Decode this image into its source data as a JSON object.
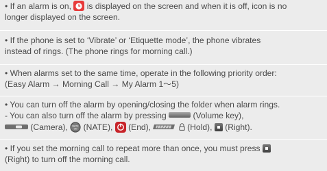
{
  "items": [
    {
      "lines": [
        {
          "pre": "• If an alarm is on,",
          "post": "is displayed on the screen and when it is off, icon is no"
        },
        {
          "text": "longer displayed on the screen."
        }
      ]
    },
    {
      "lines": [
        {
          "text": "• If the phone is set to ‘Vibrate’ or ‘Etiquette mode’, the phone vibrates"
        },
        {
          "text": "instead of rings. (The phone rings for morning call.)"
        }
      ]
    },
    {
      "lines": [
        {
          "text": "• When alarms set to the same time, operate in the following priority order:"
        },
        {
          "text": "(Easy Alarm → Morning Call → My Alarm 1～5)"
        }
      ]
    },
    {
      "lines": [
        {
          "text": "• You can turn off the alarm by opening/closing the folder when alarm rings."
        },
        {
          "pre": "- You can also turn off the alarm by pressing",
          "post": "(Volume key),"
        },
        {
          "t1": "(Camera),",
          "t2": "(NATE),",
          "t3": "(End),",
          "t4": "(Hold),",
          "t5": "(Right)."
        }
      ]
    },
    {
      "lines": [
        {
          "pre": "• If you set the morning call to repeat more than once, you must press"
        },
        {
          "text": "(Right) to turn off the morning call."
        }
      ]
    }
  ],
  "icons": {
    "alarm": "alarm-clock-icon",
    "volume": "volume-key-icon",
    "camera": "camera-key-icon",
    "nate": "nate-key-icon",
    "nate_label": "NATE",
    "nate_label_2": "ON",
    "end": "end-key-icon",
    "hold": "hold-key-icon",
    "lock": "lock-icon",
    "right": "right-key-icon"
  },
  "colors": {
    "background": "#ececec",
    "text": "#4a4a4a",
    "separator": "#ffffff",
    "alarm_red": "#e83a3a",
    "end_red": "#c8242a"
  }
}
